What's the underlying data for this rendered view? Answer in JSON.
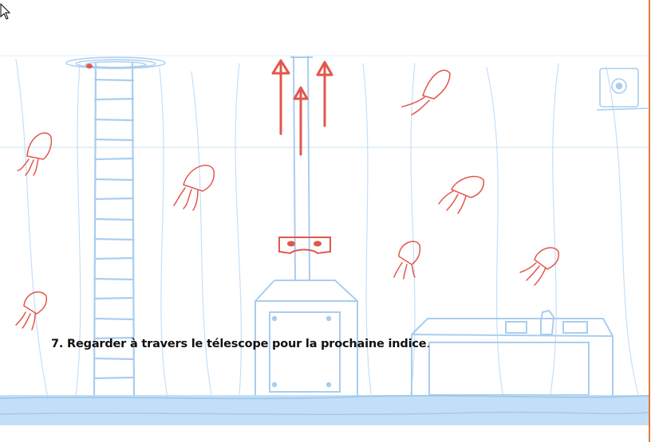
{
  "instruction": {
    "text": "7. Regarder à travers le télescope pour la prochaine indice",
    "end": "."
  },
  "scene": {
    "sketch_blue": "#a9cdef",
    "sketch_red": "#e2574c",
    "floor_blue": "#b9d9f6",
    "border_accent": "#e07b39"
  }
}
